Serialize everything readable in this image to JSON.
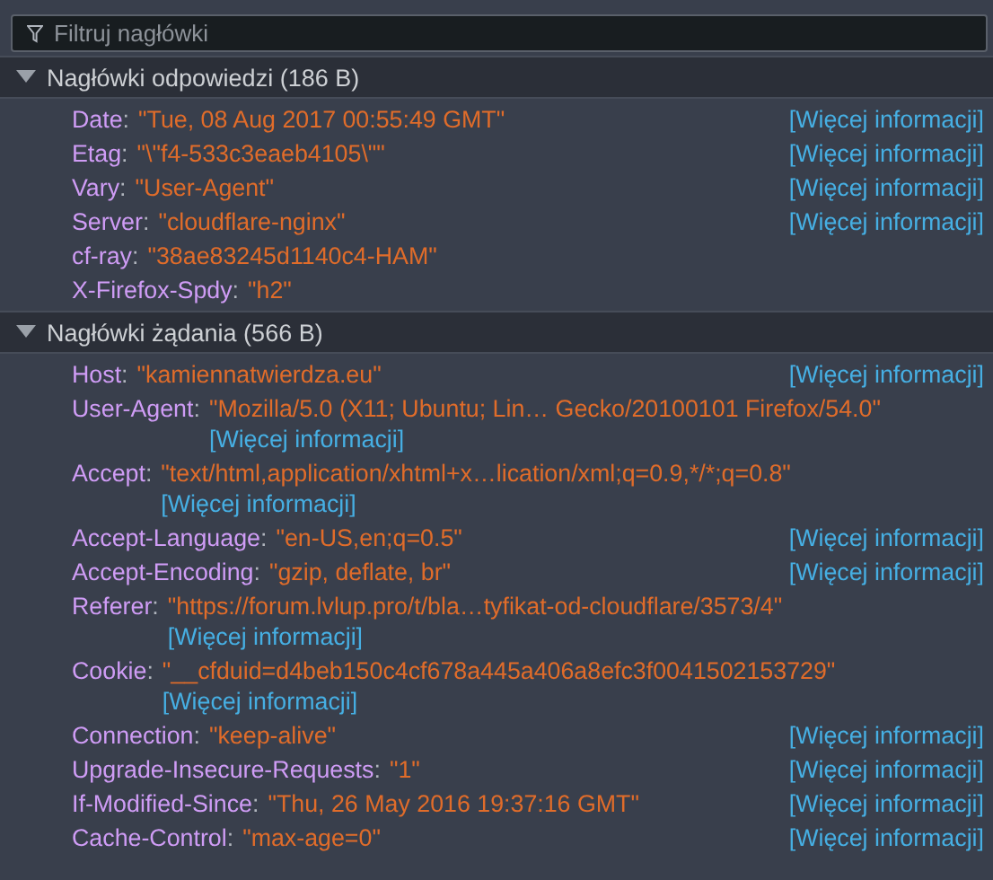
{
  "filter": {
    "placeholder": "Filtruj nagłówki"
  },
  "sections": [
    {
      "title": "Nagłówki odpowiedzi (186 B)",
      "expanded": true,
      "headers": [
        {
          "name": "Date",
          "separator": ":",
          "value": "\"Tue, 08 Aug 2017 00:55:49 GMT\"",
          "link": "[Więcej informacji]"
        },
        {
          "name": "Etag",
          "separator": ":",
          "value": "\"\\\"f4-533c3eaeb4105\\\"\"",
          "link": "[Więcej informacji]"
        },
        {
          "name": "Vary",
          "separator": ":",
          "value": "\"User-Agent\"",
          "link": "[Więcej informacji]"
        },
        {
          "name": "Server",
          "separator": ":",
          "value": "\"cloudflare-nginx\"",
          "link": "[Więcej informacji]"
        },
        {
          "name": "cf-ray",
          "separator": ":",
          "value": "\"38ae83245d1140c4-HAM\""
        },
        {
          "name": "X-Firefox-Spdy",
          "separator": ":",
          "value": "\"h2\""
        }
      ]
    },
    {
      "title": "Nagłówki żądania (566 B)",
      "expanded": true,
      "headers": [
        {
          "name": "Host",
          "separator": ":",
          "value": "\"kamiennatwierdza.eu\"",
          "link": "[Więcej informacji]"
        },
        {
          "name": "User-Agent",
          "separator": ":",
          "value": "\"Mozilla/5.0 (X11; Ubuntu; Lin… Gecko/20100101 Firefox/54.0\"",
          "link": "[Więcej informacji]"
        },
        {
          "name": "Accept",
          "separator": ":",
          "value": "\"text/html,application/xhtml+x…lication/xml;q=0.9,*/*;q=0.8\"",
          "link": "[Więcej informacji]"
        },
        {
          "name": "Accept-Language",
          "separator": ":",
          "value": "\"en-US,en;q=0.5\"",
          "link": "[Więcej informacji]"
        },
        {
          "name": "Accept-Encoding",
          "separator": ":",
          "value": "\"gzip, deflate, br\"",
          "link": "[Więcej informacji]"
        },
        {
          "name": "Referer",
          "separator": ":",
          "value": "\"https://forum.lvlup.pro/t/bla…tyfikat-od-cloudflare/3573/4\"",
          "link": "[Więcej informacji]"
        },
        {
          "name": "Cookie",
          "separator": ":",
          "value": "\"__cfduid=d4beb150c4cf678a445a406a8efc3f0041502153729\"",
          "link": "[Więcej informacji]"
        },
        {
          "name": "Connection",
          "separator": ":",
          "value": "\"keep-alive\"",
          "link": "[Więcej informacji]"
        },
        {
          "name": "Upgrade-Insecure-Requests",
          "separator": ":",
          "value": "\"1\"",
          "link": "[Więcej informacji]"
        },
        {
          "name": "If-Modified-Since",
          "separator": ":",
          "value": "\"Thu, 26 May 2016 19:37:16 GMT\"",
          "link": "[Więcej informacji]"
        },
        {
          "name": "Cache-Control",
          "separator": ":",
          "value": "\"max-age=0\"",
          "link": "[Więcej informacji]"
        }
      ]
    }
  ]
}
